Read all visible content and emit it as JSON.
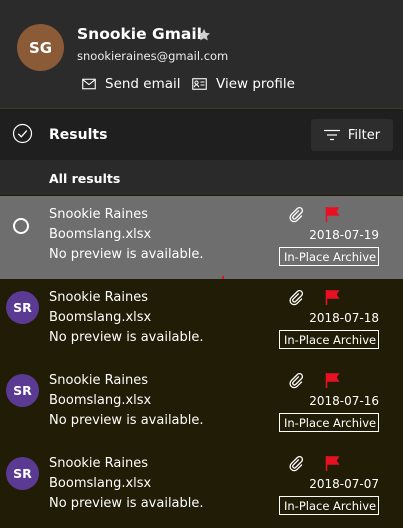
{
  "contact": {
    "initials": "SG",
    "name": "Snookie Gmail",
    "email": "snookieraines@gmail.com",
    "send_email_label": "Send email",
    "view_profile_label": "View profile",
    "avatar_color": "#8b5a36"
  },
  "results_header": {
    "title": "Results",
    "filter_label": "Filter"
  },
  "section_label": "All results",
  "results": [
    {
      "sender": "Snookie Raines",
      "subject": "Boomslang.xlsx",
      "preview": "No preview is available.",
      "date": "2018-07-19",
      "folder": "In-Place Archive",
      "selected": true,
      "has_attachment": true,
      "flagged": true
    },
    {
      "initials": "SR",
      "sender": "Snookie Raines",
      "subject": "Boomslang.xlsx",
      "preview": "No preview is available.",
      "date": "2018-07-18",
      "folder": "In-Place Archive",
      "selected": false,
      "has_attachment": true,
      "flagged": true
    },
    {
      "initials": "SR",
      "sender": "Snookie Raines",
      "subject": "Boomslang.xlsx",
      "preview": "No preview is available.",
      "date": "2018-07-16",
      "folder": "In-Place Archive",
      "selected": false,
      "has_attachment": true,
      "flagged": true
    },
    {
      "initials": "SR",
      "sender": "Snookie Raines",
      "subject": "Boomslang.xlsx",
      "preview": "No preview is available.",
      "date": "2018-07-07",
      "folder": "In-Place Archive",
      "selected": false,
      "has_attachment": true,
      "flagged": true
    }
  ],
  "icons": {
    "favorite": "star-icon",
    "send_email": "mail-icon",
    "view_profile": "contact-card-icon",
    "select_all": "check-circle-icon",
    "filter": "filter-lines-icon",
    "attachment": "paperclip-icon",
    "flag": "flag-icon"
  },
  "colors": {
    "flag": "#e81123",
    "selected_row": "#6e6e6e",
    "list_background": "#201c05",
    "sender_avatar": "#5b3a94"
  }
}
